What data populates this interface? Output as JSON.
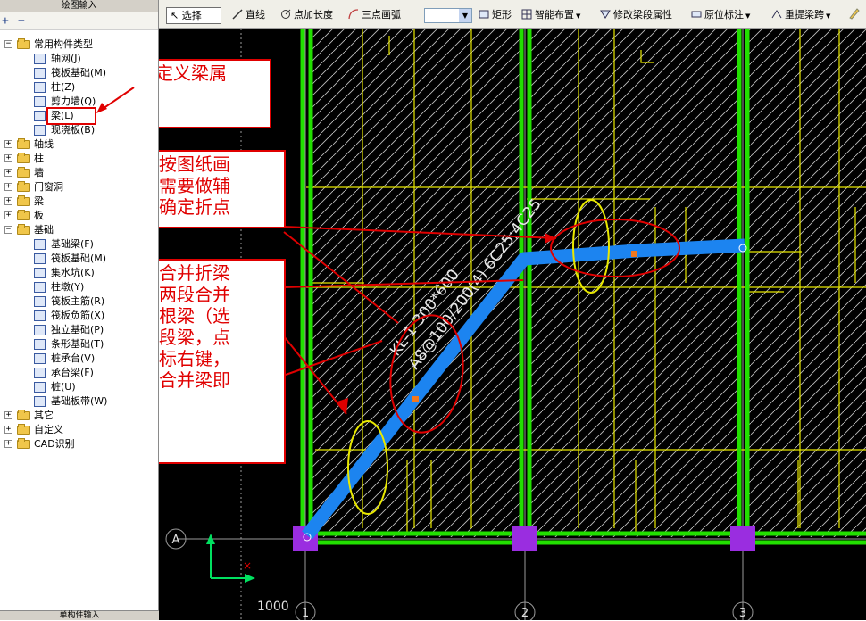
{
  "left_panel": {
    "title": "绘图输入",
    "tool_add": "+",
    "tool_collapse": "−",
    "tree": [
      {
        "label": "常用构件类型",
        "level": 0,
        "kind": "folder",
        "expanded": true,
        "icon": "folder-icon"
      },
      {
        "label": "轴网(J)",
        "level": 1,
        "kind": "item",
        "icon": "axis-grid-icon"
      },
      {
        "label": "筏板基础(M)",
        "level": 1,
        "kind": "item",
        "icon": "raft-foundation-icon"
      },
      {
        "label": "柱(Z)",
        "level": 1,
        "kind": "item",
        "icon": "column-icon"
      },
      {
        "label": "剪力墙(Q)",
        "level": 1,
        "kind": "item",
        "icon": "shear-wall-icon"
      },
      {
        "label": "梁(L)",
        "level": 1,
        "kind": "item",
        "icon": "beam-icon",
        "highlighted": true
      },
      {
        "label": "现浇板(B)",
        "level": 1,
        "kind": "item",
        "icon": "slab-icon"
      },
      {
        "label": "轴线",
        "level": 0,
        "kind": "folder",
        "expanded": false,
        "icon": "folder-icon"
      },
      {
        "label": "柱",
        "level": 0,
        "kind": "folder",
        "expanded": false,
        "icon": "folder-icon"
      },
      {
        "label": "墙",
        "level": 0,
        "kind": "folder",
        "expanded": false,
        "icon": "folder-icon"
      },
      {
        "label": "门窗洞",
        "level": 0,
        "kind": "folder",
        "expanded": false,
        "icon": "folder-icon"
      },
      {
        "label": "梁",
        "level": 0,
        "kind": "folder",
        "expanded": false,
        "icon": "folder-icon"
      },
      {
        "label": "板",
        "level": 0,
        "kind": "folder",
        "expanded": false,
        "icon": "folder-icon"
      },
      {
        "label": "基础",
        "level": 0,
        "kind": "folder",
        "expanded": true,
        "icon": "folder-icon"
      },
      {
        "label": "基础梁(F)",
        "level": 1,
        "kind": "item",
        "icon": "foundation-beam-icon"
      },
      {
        "label": "筏板基础(M)",
        "level": 1,
        "kind": "item",
        "icon": "raft-foundation-icon"
      },
      {
        "label": "集水坑(K)",
        "level": 1,
        "kind": "item",
        "icon": "sump-pit-icon"
      },
      {
        "label": "柱墩(Y)",
        "level": 1,
        "kind": "item",
        "icon": "column-pier-icon"
      },
      {
        "label": "筏板主筋(R)",
        "level": 1,
        "kind": "item",
        "icon": "raft-main-rebar-icon"
      },
      {
        "label": "筏板负筋(X)",
        "level": 1,
        "kind": "item",
        "icon": "raft-negative-rebar-icon"
      },
      {
        "label": "独立基础(P)",
        "level": 1,
        "kind": "item",
        "icon": "isolated-footing-icon"
      },
      {
        "label": "条形基础(T)",
        "level": 1,
        "kind": "item",
        "icon": "strip-footing-icon"
      },
      {
        "label": "桩承台(V)",
        "level": 1,
        "kind": "item",
        "icon": "pile-cap-icon"
      },
      {
        "label": "承台梁(F)",
        "level": 1,
        "kind": "item",
        "icon": "cap-beam-icon"
      },
      {
        "label": "桩(U)",
        "level": 1,
        "kind": "item",
        "icon": "pile-icon"
      },
      {
        "label": "基础板带(W)",
        "level": 1,
        "kind": "item",
        "icon": "foundation-strip-icon"
      },
      {
        "label": "其它",
        "level": 0,
        "kind": "folder",
        "expanded": false,
        "icon": "folder-icon"
      },
      {
        "label": "自定义",
        "level": 0,
        "kind": "folder",
        "expanded": false,
        "icon": "folder-icon"
      },
      {
        "label": "CAD识别",
        "level": 0,
        "kind": "folder",
        "expanded": false,
        "icon": "folder-icon"
      }
    ],
    "bottom_tab": "单构件输入"
  },
  "toolbar": {
    "select_label": "选择",
    "line_label": "直线",
    "point_length_label": "点加长度",
    "three_point_arc_label": "三点画弧",
    "rect_label": "矩形",
    "smart_layout_label": "智能布置",
    "modify_segment_label": "修改梁段属性",
    "in_situ_label": "原位标注",
    "respan_label": "重提梁跨"
  },
  "canvas": {
    "axis_labels": [
      "1",
      "2",
      "3"
    ],
    "row_label": "A",
    "dimension": "1000",
    "beam_label_1": "KL-1 300*600",
    "beam_label_2": "A8@100/200(4) 6C25;4C25",
    "colors": {
      "background": "#000000",
      "column_green": "#22e000",
      "beam_blue": "#1c84f0",
      "grid_yellow": "#e8e800",
      "hatch": "#c8c8c8",
      "pedestal_purple": "#9a2de0",
      "axis_gray": "#9a9a9a"
    }
  },
  "annotations": {
    "note1": "先定义梁属\n性",
    "note2": "然后按图纸画\n梁，需要做辅\n助线确定折点",
    "note3": "下来合并折梁\n，把两段合并\n成一根梁（选\n中两段梁，点\n击鼠标右键，\n点击合并梁即\n可）"
  }
}
